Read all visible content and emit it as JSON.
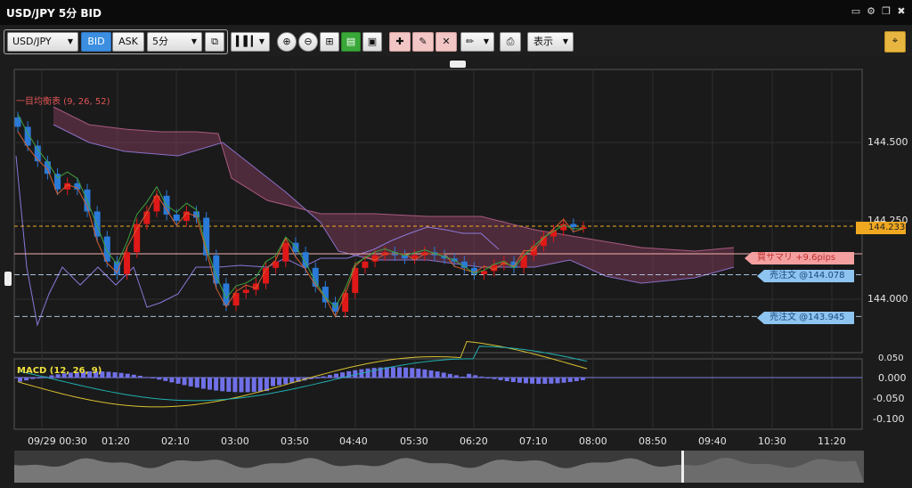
{
  "window": {
    "title": "USD/JPY 5分 BID",
    "controls": [
      "minimize-icon",
      "gear-icon",
      "restore-icon",
      "close-icon"
    ]
  },
  "toolbar": {
    "symbol": "USD/JPY",
    "bid_label": "BID",
    "ask_label": "ASK",
    "timeframe": "5分",
    "display_label": "表示"
  },
  "colors": {
    "bg": "#1c1c1c",
    "up": "#e01818",
    "down": "#2a7ad8",
    "cloud_fill": "#7a3a55",
    "bid_price_tag": "#f0a820",
    "buy_position_tag": "#f4a0a0",
    "sell_order_tag": "#8ec4f0",
    "macd_hist": "#7070e8"
  },
  "price_axis": {
    "ticks": [
      "144.500",
      "144.250",
      "144.000"
    ],
    "current_price": "144.233"
  },
  "macd_axis": {
    "ticks": [
      "0.050",
      "0.000",
      "-0.050",
      "-0.100"
    ]
  },
  "time_axis": {
    "ticks": [
      "09/29 00:30",
      "01:20",
      "02:10",
      "03:00",
      "03:50",
      "04:40",
      "05:30",
      "06:20",
      "07:10",
      "08:00",
      "08:50",
      "09:40",
      "10:30",
      "11:20"
    ]
  },
  "indicators": {
    "ichimoku_label": "一目均衡表 (9, 26, 52)",
    "macd_label": "MACD (12, 26, 9)"
  },
  "position_tags": {
    "buy_summary": "買サマリ +9.6pips",
    "sell_order_1": "売注文 @144.078",
    "sell_order_2": "売注文 @143.945"
  },
  "chart_data": {
    "type": "candlestick",
    "symbol": "USD/JPY",
    "interval": "5分",
    "y_range": [
      143.87,
      144.6
    ],
    "price_lines": {
      "current": 144.233,
      "buy_position": 144.145,
      "sell_order_1": 144.078,
      "sell_order_2": 143.945
    },
    "closes": [
      144.55,
      144.49,
      144.44,
      144.4,
      144.35,
      144.37,
      144.35,
      144.28,
      144.2,
      144.12,
      144.08,
      144.15,
      144.24,
      144.28,
      144.33,
      144.27,
      144.25,
      144.28,
      144.26,
      144.14,
      144.05,
      143.98,
      144.02,
      144.03,
      144.05,
      144.1,
      144.12,
      144.18,
      144.15,
      144.1,
      144.04,
      143.99,
      143.96,
      144.02,
      144.1,
      144.12,
      144.14,
      144.15,
      144.14,
      144.13,
      144.14,
      144.15,
      144.14,
      144.13,
      144.12,
      144.1,
      144.08,
      144.09,
      144.11,
      144.12,
      144.1,
      144.14,
      144.17,
      144.2,
      144.22,
      144.24,
      144.23,
      144.23
    ],
    "macd_range": [
      -0.11,
      0.06
    ]
  }
}
